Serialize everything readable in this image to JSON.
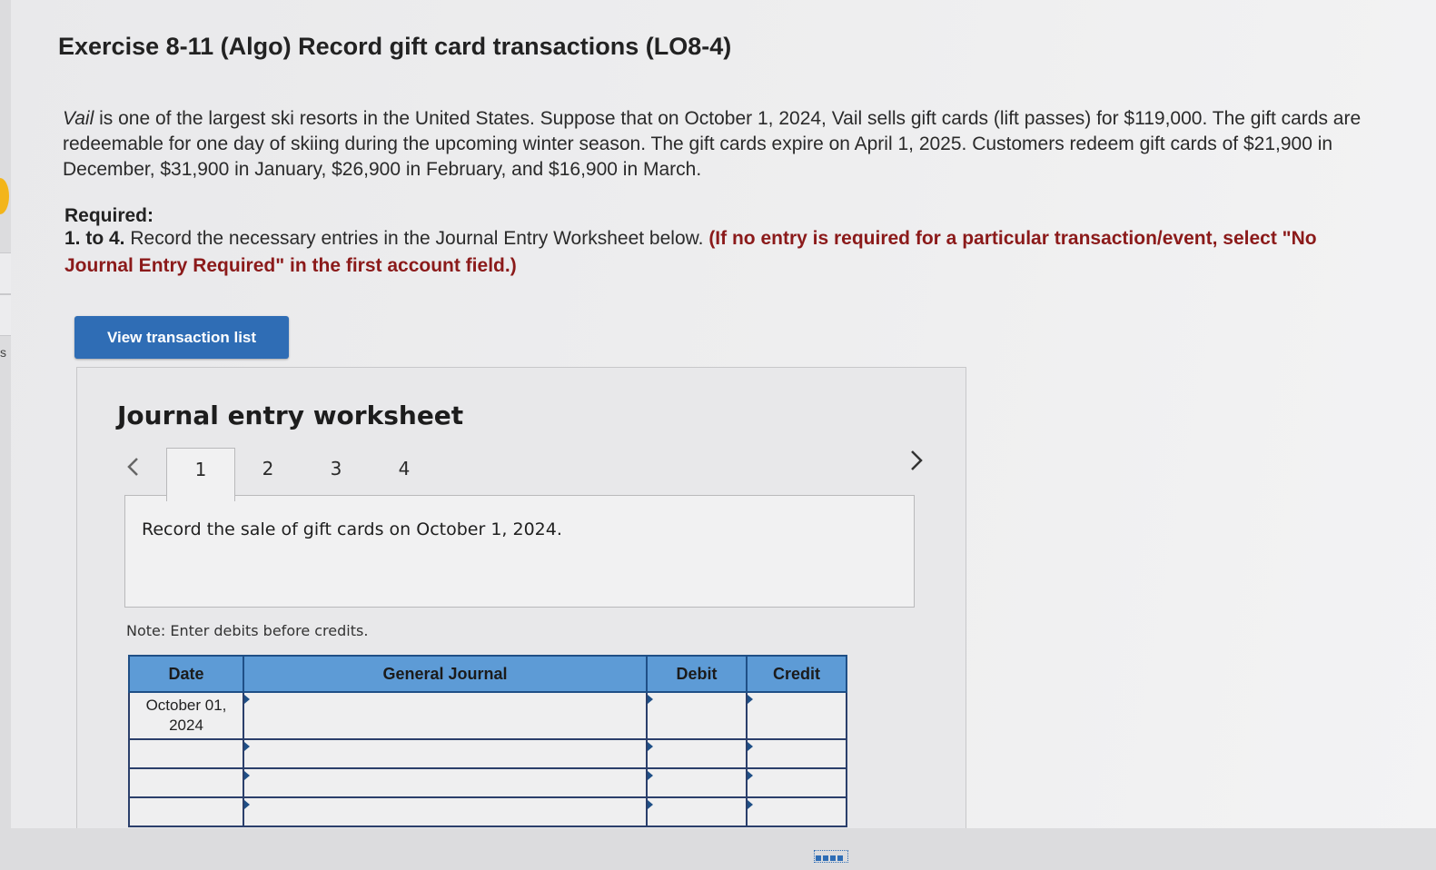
{
  "exercise": {
    "title": "Exercise 8-11 (Algo) Record gift card transactions (LO8-4)",
    "intro_company": "Vail",
    "intro_text": " is one of the largest ski resorts in the United States. Suppose that on October 1, 2024, Vail sells gift cards (lift passes) for $119,000. The gift cards are redeemable for one day of skiing during the upcoming winter season. The gift cards expire on April 1, 2025. Customers redeem gift cards of $21,900 in December, $31,900 in January, $26,900 in February, and $16,900 in March."
  },
  "required": {
    "label": "Required:",
    "range": "1. to 4.",
    "instruction": " Record the necessary entries in the Journal Entry Worksheet below. ",
    "note_red": "(If no entry is required for a particular transaction/event, select \"No Journal Entry Required\" in the first account field.)"
  },
  "buttons": {
    "view_transaction_list": "View transaction list"
  },
  "edge": {
    "letter": "s"
  },
  "worksheet": {
    "title": "Journal entry worksheet",
    "tabs": [
      "1",
      "2",
      "3",
      "4"
    ],
    "active_tab": "1",
    "panel_text": "Record the sale of gift cards on October 1, 2024.",
    "note": "Note: Enter debits before credits.",
    "table": {
      "headers": [
        "Date",
        "General Journal",
        "Debit",
        "Credit"
      ],
      "rows": [
        {
          "date": "October 01, 2024",
          "account": "",
          "debit": "",
          "credit": ""
        },
        {
          "date": "",
          "account": "",
          "debit": "",
          "credit": ""
        },
        {
          "date": "",
          "account": "",
          "debit": "",
          "credit": ""
        },
        {
          "date": "",
          "account": "",
          "debit": "",
          "credit": ""
        }
      ]
    }
  },
  "colors": {
    "button_blue": "#2f6db5",
    "header_blue": "#5d9bd6",
    "required_red": "#8b1a1a",
    "highlight_yellow": "#f3b51a"
  },
  "icons": [
    "chevron-left-icon",
    "chevron-right-icon",
    "entry-marker-icon",
    "grid-icon"
  ]
}
